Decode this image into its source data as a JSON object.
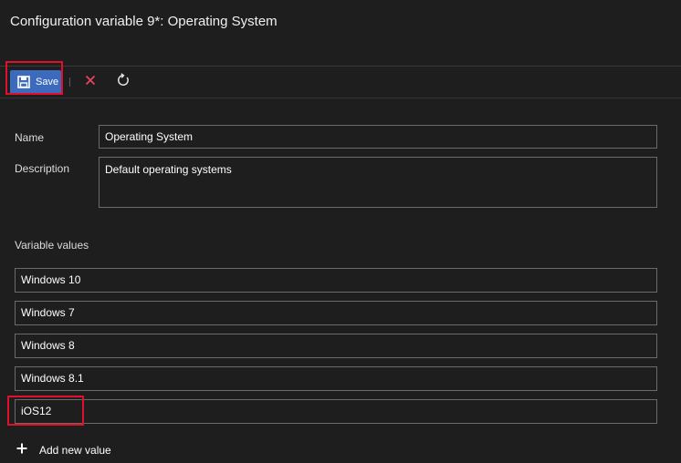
{
  "header": {
    "title": "Configuration variable 9*: Operating System"
  },
  "toolbar": {
    "save_label": "Save",
    "save_icon": "save-icon",
    "discard_icon": "close-icon",
    "refresh_icon": "refresh-icon",
    "accent_color": "#3c6bbd",
    "discard_color": "#e8455a"
  },
  "form": {
    "name_label": "Name",
    "name_value": "Operating System",
    "description_label": "Description",
    "description_value": "Default operating systems",
    "values_label": "Variable values",
    "values": [
      "Windows 10",
      "Windows 7",
      "Windows 8",
      "Windows 8.1",
      "iOS12"
    ],
    "add_value_label": "Add new value",
    "add_icon": "plus-icon"
  },
  "annotations": {
    "highlight_color": "#e0102a"
  }
}
